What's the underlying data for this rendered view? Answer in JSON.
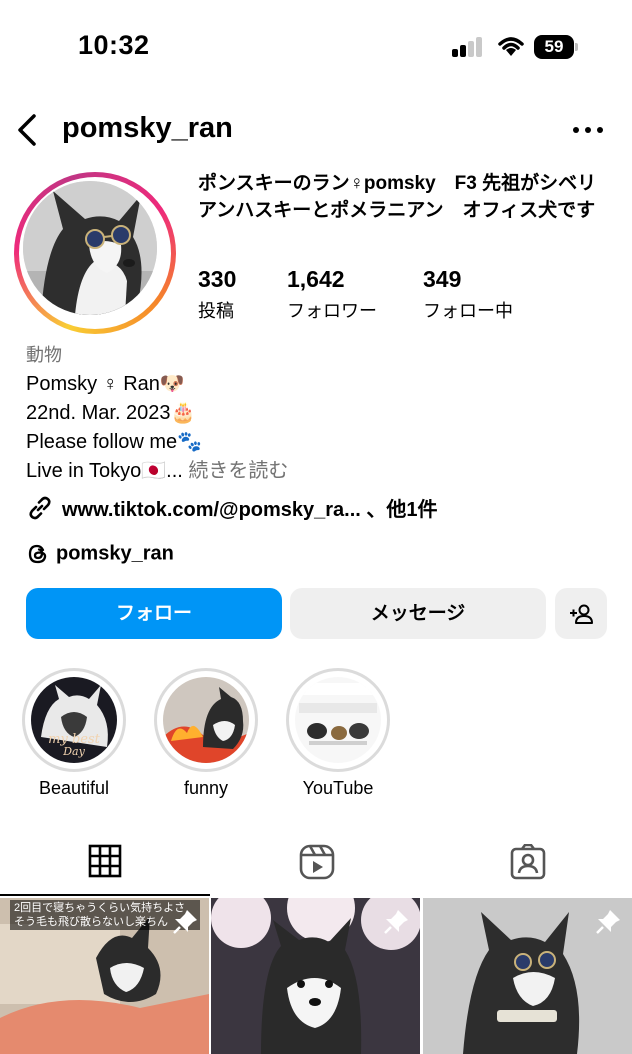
{
  "status_bar": {
    "time": "10:32",
    "battery": "59"
  },
  "header": {
    "username": "pomsky_ran"
  },
  "profile": {
    "name": "ポンスキーのラン♀pomsky　F3 先祖がシベリアンハスキーとポメラニアン　オフィス犬です",
    "stats": [
      {
        "value": "330",
        "label": "投稿"
      },
      {
        "value": "1,642",
        "label": "フォロワー"
      },
      {
        "value": "349",
        "label": "フォロー中"
      }
    ],
    "category": "動物",
    "bio_lines": [
      "Pomsky ♀ Ran🐶",
      "22nd. Mar. 2023🎂",
      "Please follow me🐾",
      "Live in Tokyo🇯🇵..."
    ],
    "more_label": "続きを読む",
    "link_text": "www.tiktok.com/@pomsky_ra... 、他1件",
    "threads_handle": "pomsky_ran"
  },
  "actions": {
    "follow_label": "フォロー",
    "message_label": "メッセージ",
    "add_user_icon": "add-user-icon"
  },
  "highlights": [
    {
      "label": "Beautiful"
    },
    {
      "label": "funny"
    },
    {
      "label": "YouTube"
    }
  ],
  "tabs": [
    {
      "icon": "grid-icon"
    },
    {
      "icon": "reels-icon"
    },
    {
      "icon": "tagged-icon"
    }
  ],
  "posts": [
    {
      "overlay": "2回目で寝ちゃうくらい気持ちよさそう毛も飛び散らないし楽ちん",
      "pinned": true
    },
    {
      "overlay": "",
      "pinned": true
    },
    {
      "overlay": "",
      "pinned": true
    }
  ],
  "colors": {
    "accent": "#0095f6",
    "muted": "#737373",
    "button_bg": "#efefef"
  }
}
